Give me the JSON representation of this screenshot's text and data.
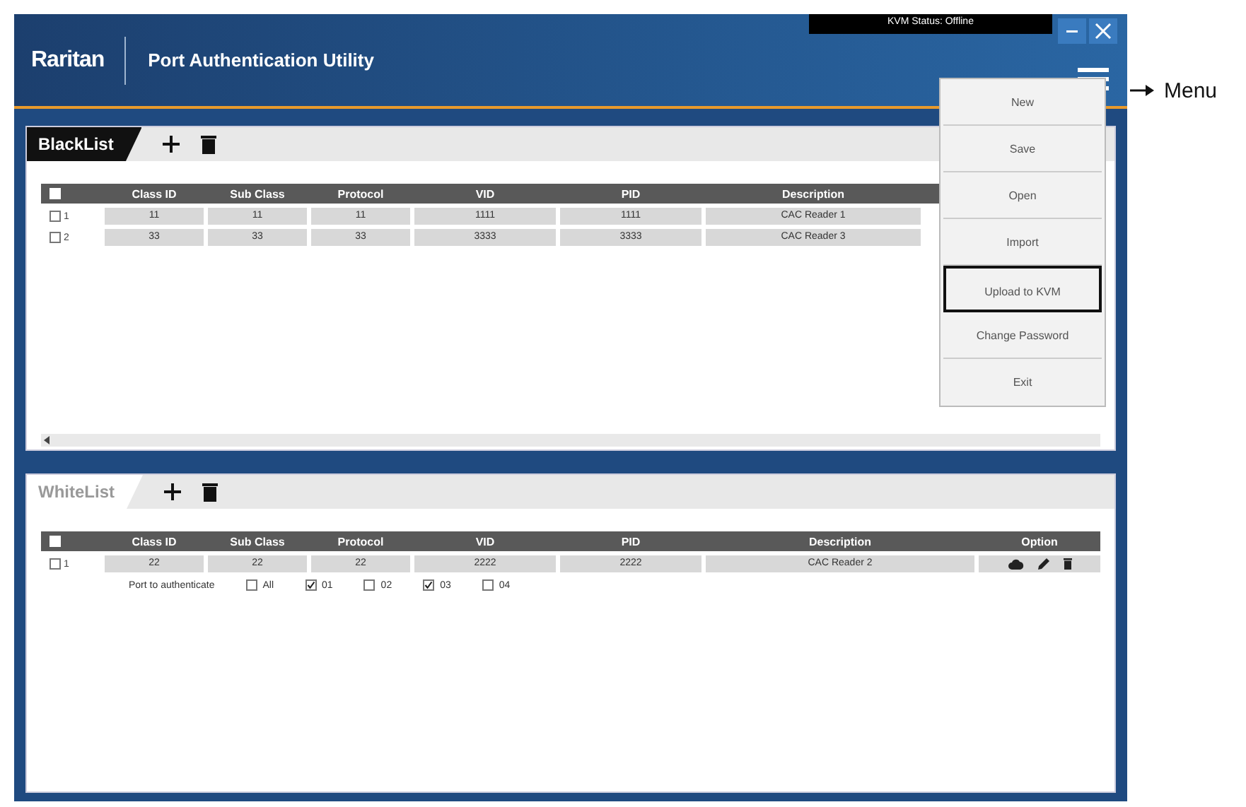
{
  "window": {
    "logo": "Raritan",
    "title": "Port Authentication Utility",
    "kvm_status": "KVM Status: Offline"
  },
  "panels": [
    {
      "tab": {
        "label": "BlackList",
        "selected": true
      },
      "select_all_checked": false,
      "columns": [
        "Class ID",
        "Sub Class",
        "Protocol",
        "VID",
        "PID",
        "Description"
      ],
      "rows": [
        {
          "checked": false,
          "number": "1",
          "cells": [
            "11",
            "11",
            "11",
            "1111",
            "1111",
            "CAC Reader 1"
          ]
        },
        {
          "checked": false,
          "number": "2",
          "cells": [
            "33",
            "33",
            "33",
            "3333",
            "3333",
            "CAC Reader 3"
          ]
        }
      ],
      "scrollbar": true
    },
    {
      "tab": {
        "label": "WhiteList",
        "selected": false
      },
      "select_all_checked": false,
      "columns": [
        "Class ID",
        "Sub Class",
        "Protocol",
        "VID",
        "PID",
        "Description",
        "Option"
      ],
      "rows": [
        {
          "checked": false,
          "number": "1",
          "cells": [
            "22",
            "22",
            "22",
            "2222",
            "2222",
            "CAC Reader 2"
          ],
          "options": true,
          "ports": {
            "label": "Port to authenticate",
            "items": [
              {
                "label": "All",
                "checked": false
              },
              {
                "label": "01",
                "checked": true
              },
              {
                "label": "02",
                "checked": false
              },
              {
                "label": "03",
                "checked": true
              },
              {
                "label": "04",
                "checked": false
              }
            ]
          }
        }
      ],
      "scrollbar": false
    }
  ],
  "menu": {
    "items": [
      {
        "label": "New",
        "highlighted": false
      },
      {
        "label": "Save",
        "highlighted": false
      },
      {
        "label": "Open",
        "highlighted": false
      },
      {
        "label": "Import",
        "highlighted": false
      },
      {
        "label": "Upload to KVM",
        "highlighted": true
      },
      {
        "label": "Change Password",
        "highlighted": false
      },
      {
        "label": "Exit",
        "highlighted": false
      }
    ]
  },
  "annotation": "Menu"
}
